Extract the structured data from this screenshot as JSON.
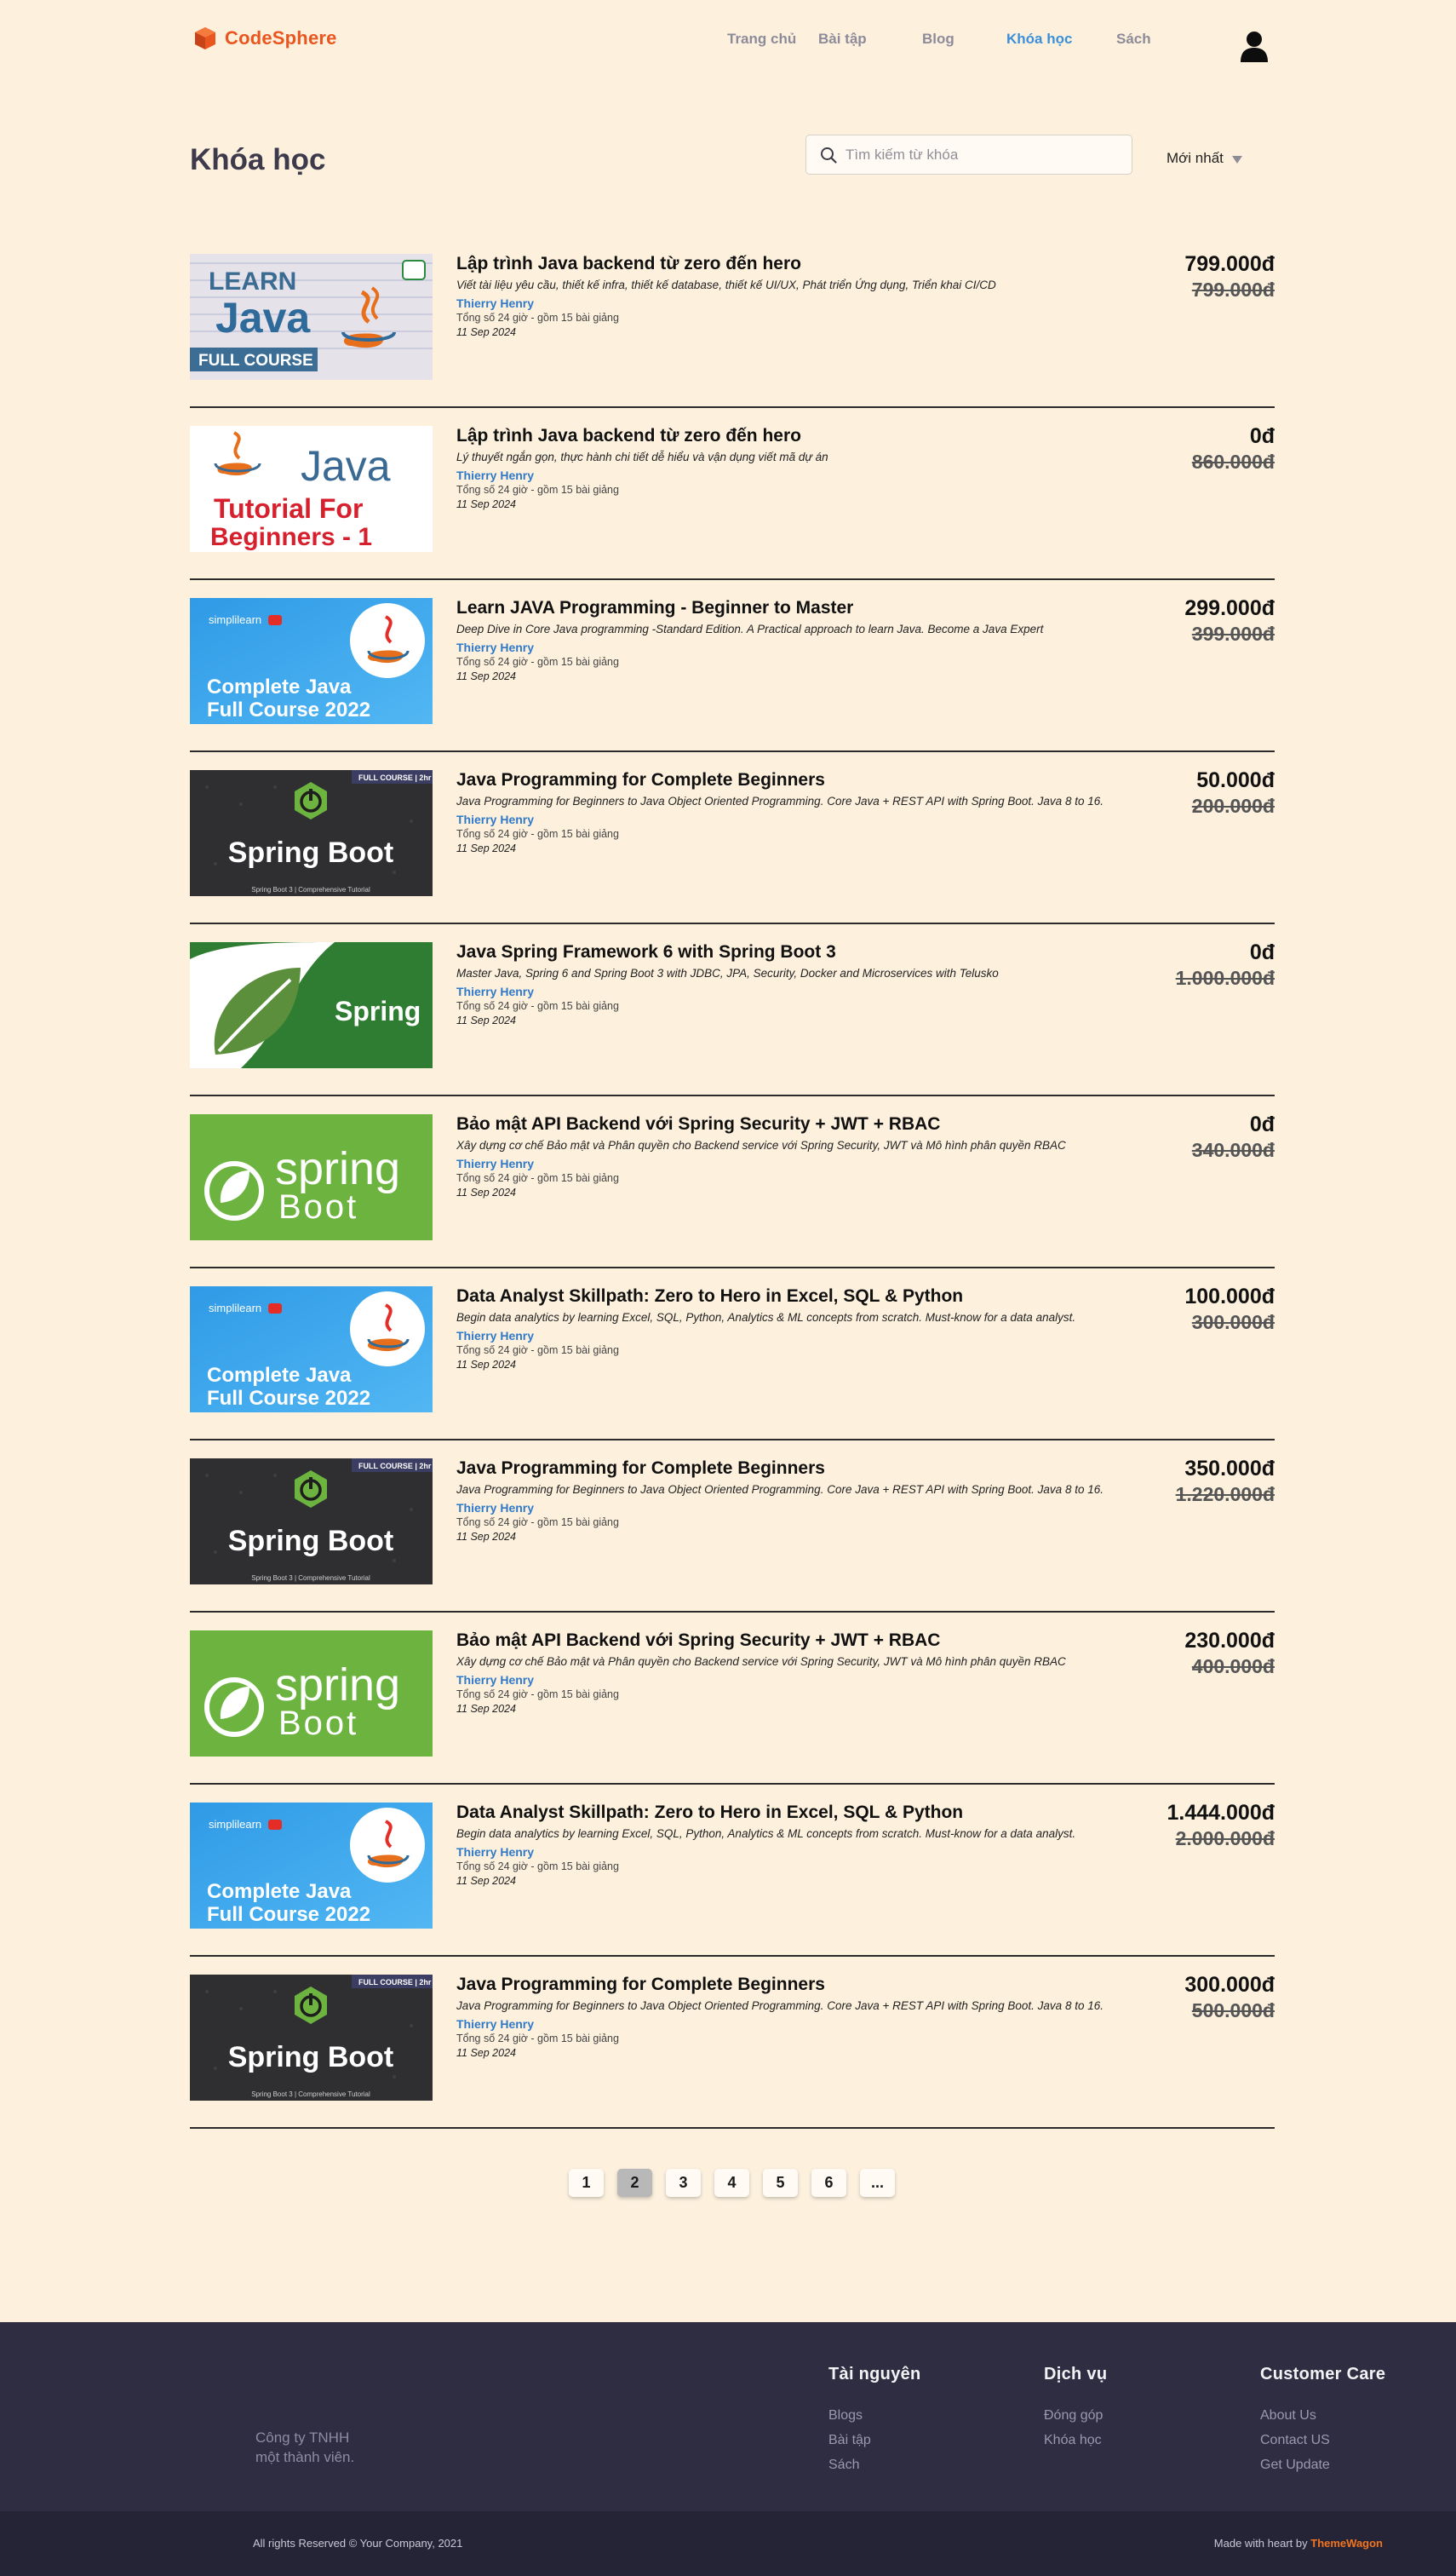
{
  "brand": {
    "name": "CodeSphere",
    "color": "#e9561f"
  },
  "nav": {
    "items": [
      {
        "label": "Trang chủ",
        "active": false
      },
      {
        "label": "Bài tập",
        "active": false
      },
      {
        "label": "Blog",
        "active": false
      },
      {
        "label": "Khóa học",
        "active": true
      },
      {
        "label": "Sách",
        "active": false
      }
    ],
    "accent": "#3b8fd8"
  },
  "page": {
    "title": "Khóa học"
  },
  "search": {
    "placeholder": "Tìm kiếm từ khóa",
    "value": ""
  },
  "sort": {
    "label": "Mới nhất"
  },
  "courses": [
    {
      "thumb": "learn-java-full-course",
      "title": "Lập trình Java backend từ zero đến hero",
      "desc": "Viết tài liệu yêu cầu, thiết kế infra, thiết kế database, thiết kế UI/UX, Phát triển Ứng dụng, Triển khai CI/CD",
      "author": "Thierry Henry",
      "meta": "Tổng số 24 giờ - gồm 15 bài giảng",
      "date": "11 Sep 2024",
      "price": "799.000đ",
      "old_price": "799.000đ"
    },
    {
      "thumb": "java-tutorial-beginners",
      "title": "Lập trình Java backend từ zero đến hero",
      "desc": "Lý thuyết ngắn gọn, thực hành chi tiết dễ hiểu và vận dụng viết mã dự án",
      "author": "Thierry Henry",
      "meta": "Tổng số 24 giờ - gồm 15 bài giảng",
      "date": "11 Sep 2024",
      "price": "0đ",
      "old_price": "860.000đ"
    },
    {
      "thumb": "simplilearn-complete-java",
      "title": "Learn JAVA Programming - Beginner to Master",
      "desc": "Deep Dive in Core Java programming -Standard Edition. A Practical approach to learn Java. Become a Java Expert",
      "author": "Thierry Henry",
      "meta": "Tổng số 24 giờ - gồm 15 bài giảng",
      "date": "11 Sep 2024",
      "price": "299.000đ",
      "old_price": "399.000đ"
    },
    {
      "thumb": "spring-boot-dark",
      "title": "Java Programming for Complete Beginners",
      "desc": "Java Programming for Beginners to Java Object Oriented Programming. Core Java + REST API with Spring Boot. Java 8 to 16.",
      "author": "Thierry Henry",
      "meta": "Tổng số 24 giờ - gồm 15 bài giảng",
      "date": "11 Sep 2024",
      "price": "50.000đ",
      "old_price": "200.000đ"
    },
    {
      "thumb": "spring-leaf",
      "title": "Java Spring Framework 6 with Spring Boot 3",
      "desc": "Master Java, Spring 6 and Spring Boot 3 with JDBC, JPA, Security, Docker and Microservices with Telusko",
      "author": "Thierry Henry",
      "meta": "Tổng số 24 giờ - gồm 15 bài giảng",
      "date": "11 Sep 2024",
      "price": "0đ",
      "old_price": "1.000.000đ"
    },
    {
      "thumb": "spring-boot-green",
      "title": "Bảo mật API Backend với Spring Security + JWT + RBAC",
      "desc": "Xây dựng cơ chế Bảo mật và Phân quyền cho Backend service với Spring Security, JWT và Mô hình phân quyền RBAC",
      "author": "Thierry Henry",
      "meta": "Tổng số 24 giờ - gồm 15 bài giảng",
      "date": "11 Sep 2024",
      "price": "0đ",
      "old_price": "340.000đ"
    },
    {
      "thumb": "simplilearn-complete-java",
      "title": "Data Analyst Skillpath: Zero to Hero in Excel, SQL & Python",
      "desc": "Begin data analytics by learning Excel, SQL, Python, Analytics & ML concepts from scratch. Must-know for a data analyst.",
      "author": "Thierry Henry",
      "meta": "Tổng số 24 giờ - gồm 15 bài giảng",
      "date": "11 Sep 2024",
      "price": "100.000đ",
      "old_price": "300.000đ"
    },
    {
      "thumb": "spring-boot-dark",
      "title": "Java Programming for Complete Beginners",
      "desc": "Java Programming for Beginners to Java Object Oriented Programming. Core Java + REST API with Spring Boot. Java 8 to 16.",
      "author": "Thierry Henry",
      "meta": "Tổng số 24 giờ - gồm 15 bài giảng",
      "date": "11 Sep 2024",
      "price": "350.000đ",
      "old_price": "1.220.000đ"
    },
    {
      "thumb": "spring-boot-green",
      "title": "Bảo mật API Backend với Spring Security + JWT + RBAC",
      "desc": "Xây dựng cơ chế Bảo mật và Phân quyền cho Backend service với Spring Security, JWT và Mô hình phân quyền RBAC",
      "author": "Thierry Henry",
      "meta": "Tổng số 24 giờ - gồm 15 bài giảng",
      "date": "11 Sep 2024",
      "price": "230.000đ",
      "old_price": "400.000đ"
    },
    {
      "thumb": "simplilearn-complete-java",
      "title": "Data Analyst Skillpath: Zero to Hero in Excel, SQL & Python",
      "desc": "Begin data analytics by learning Excel, SQL, Python, Analytics & ML concepts from scratch. Must-know for a data analyst.",
      "author": "Thierry Henry",
      "meta": "Tổng số 24 giờ - gồm 15 bài giảng",
      "date": "11 Sep 2024",
      "price": "1.444.000đ",
      "old_price": "2.000.000đ"
    },
    {
      "thumb": "spring-boot-dark",
      "title": "Java Programming for Complete Beginners",
      "desc": "Java Programming for Beginners to Java Object Oriented Programming. Core Java + REST API with Spring Boot. Java 8 to 16.",
      "author": "Thierry Henry",
      "meta": "Tổng số 24 giờ - gồm 15 bài giảng",
      "date": "11 Sep 2024",
      "price": "300.000đ",
      "old_price": "500.000đ"
    }
  ],
  "pagination": {
    "pages": [
      "1",
      "2",
      "3",
      "4",
      "5",
      "6",
      "..."
    ],
    "current": "2"
  },
  "footer": {
    "company_line1": "Công ty TNHH",
    "company_line2": "một thành viên.",
    "columns": [
      {
        "title": "Tài nguyên",
        "items": [
          "Blogs",
          "Bài tập",
          "Sách"
        ]
      },
      {
        "title": "Dịch vụ",
        "items": [
          "Đóng góp",
          "Khóa học"
        ]
      },
      {
        "title": "Customer Care",
        "items": [
          "About Us",
          "Contact US",
          "Get Update"
        ]
      }
    ],
    "copyright": "All rights Reserved © Your Company, 2021",
    "made_with_prefix": "Made with heart by",
    "made_with_brand": "ThemeWagon"
  },
  "thumb_text": {
    "learn_java": {
      "line1": "LEARN",
      "line2": "Java",
      "line3": "FULL COURSE"
    },
    "java_tutorial": {
      "line1": "Java",
      "line2": "Tutorial For",
      "line3": "Beginners - 1"
    },
    "simplilearn": {
      "brand": "simplilearn",
      "line1": "Complete Java",
      "line2": "Full Course 2022"
    },
    "spring_dark": {
      "badge": "FULL COURSE | 2hr",
      "title": "Spring Boot",
      "caption": "Spring Boot 3 | Comprehensive Tutorial"
    },
    "spring_leaf": {
      "title": "Spring"
    },
    "spring_green": {
      "line1": "spring",
      "line2": "Boot"
    }
  }
}
